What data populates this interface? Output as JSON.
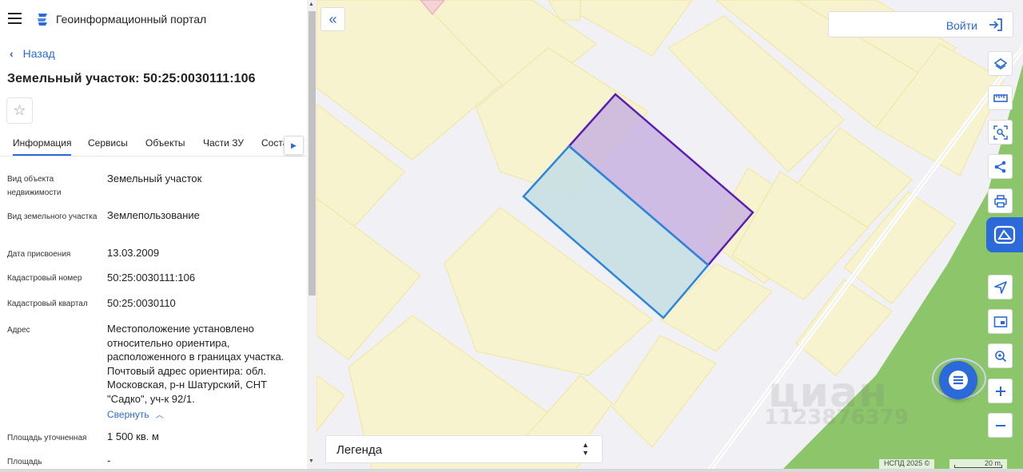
{
  "header": {
    "title": "Геоинформационный портал"
  },
  "nav": {
    "back_label": "Назад"
  },
  "page": {
    "title": "Земельный участок: 50:25:0030111:106"
  },
  "tabs": [
    {
      "label": "Информация",
      "active": true
    },
    {
      "label": "Сервисы"
    },
    {
      "label": "Объекты"
    },
    {
      "label": "Части ЗУ"
    },
    {
      "label": "Соста"
    }
  ],
  "fields": [
    {
      "label": "Вид объекта недвижимости",
      "value": "Земельный участок"
    },
    {
      "label": "Вид земельного участка",
      "value": "Землепользование"
    },
    {
      "label": "Дата присвоения",
      "value": "13.03.2009"
    },
    {
      "label": "Кадастровый номер",
      "value": "50:25:0030111:106"
    },
    {
      "label": "Кадастровый квартал",
      "value": "50:25:0030110"
    },
    {
      "label": "Адрес",
      "value": "Местоположение установлено относительно ориентира, расположенного в границах участка. Почтовый адрес ориентира: обл. Московская, р-н Шатурский, СНТ \"Садко\", уч-к 92/1."
    },
    {
      "label": "Площадь уточненная",
      "value": "1 500 кв. м"
    },
    {
      "label": "Площадь",
      "value": "-"
    }
  ],
  "collapse_label": "Свернуть",
  "map": {
    "login_label": "Войти",
    "legend_label": "Легенда",
    "copyright": "НСПД 2025 ©",
    "scale_label": "20 m",
    "watermark": "циан",
    "watermark_id": "1123876379"
  },
  "colors": {
    "accent": "#2b6ad8",
    "parcel_fill": "#f7f3cf",
    "parcel_stroke": "#f0e59a",
    "selected_purple": "#5b1fb0",
    "selected_blue": "#2d86d9",
    "forest": "#8cc56a"
  },
  "icons": {
    "menu": "hamburger-icon",
    "back": "chevron-left-icon",
    "favorite": "star-icon",
    "tools": [
      "layers-icon",
      "ruler-icon",
      "area-select-icon",
      "share-icon",
      "print-icon",
      "nspd-logo-icon",
      "locate-icon",
      "minimap-icon",
      "geo-search-icon",
      "zoom-in-icon",
      "zoom-out-icon"
    ]
  }
}
